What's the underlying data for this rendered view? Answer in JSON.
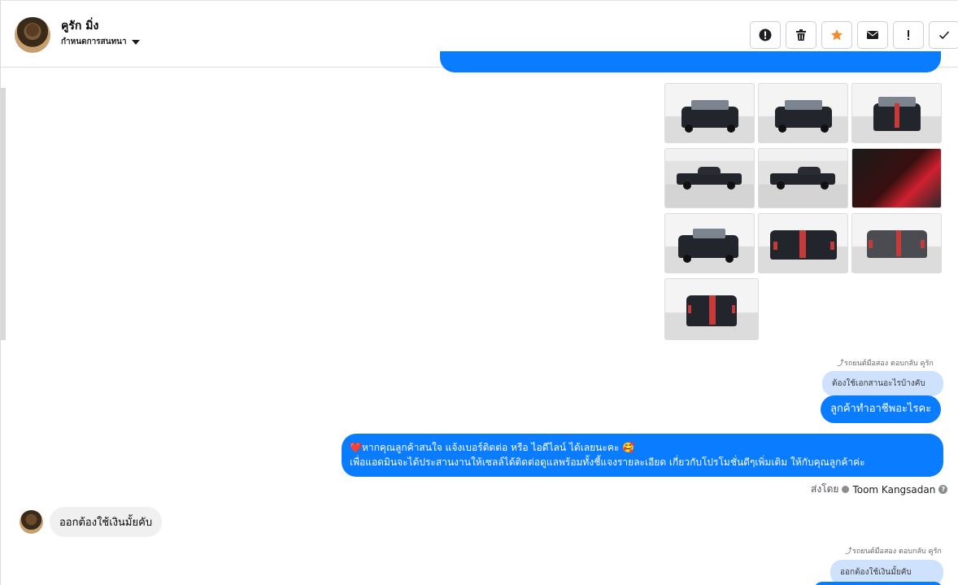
{
  "header": {
    "contact_name": "คูรัก มิ่ง",
    "stage_label": "กำหนดการสนทนา"
  },
  "actions": [
    {
      "name": "alert-icon"
    },
    {
      "name": "trash-icon"
    },
    {
      "name": "star-icon",
      "color": "#f28c28"
    },
    {
      "name": "mail-icon"
    },
    {
      "name": "exclamation-icon"
    },
    {
      "name": "check-icon"
    }
  ],
  "thread": {
    "reply_meta_1": "รถยนต์มือสอง ตอบกลับ คูรัก",
    "quoted_1": "ต้องใช้เอกสานอะไรบ้างคับ",
    "reply_1": "ลูกค้าทำอาชีพอะไรคะ",
    "promo_line1": "หากคุณลูกค้าสนใจ แจ้งเบอร์ติดต่อ หรือ ไอดีไลน์ ได้เลยนะคะ 🥰",
    "promo_heart": "❤️",
    "promo_line2": "เพื่อแอดมินจะได้ประสานงานให้เซลล์ได้ติดต่อดูแลพร้อมทั้งชี้แจงรายละเอียด เกี่ยวกับโปรโมชั่นดีๆเพิ่มเติม ให้กับคุณลูกค้าค่ะ",
    "sent_by_label": "ส่งโดย",
    "sent_by_name": "Toom Kangsadan",
    "customer_message": "ออกต้องใช้เงินมั้ยคับ",
    "reply_meta_2": "รถยนต์มือสอง ตอบกลับ คูรัก",
    "quoted_2": "ออกต้องใช้เงินมั้ยคับ"
  },
  "colors": {
    "accent": "#0a7cff",
    "quoted_bg": "#cfe2fd",
    "incoming_bg": "#f0f0f0"
  }
}
